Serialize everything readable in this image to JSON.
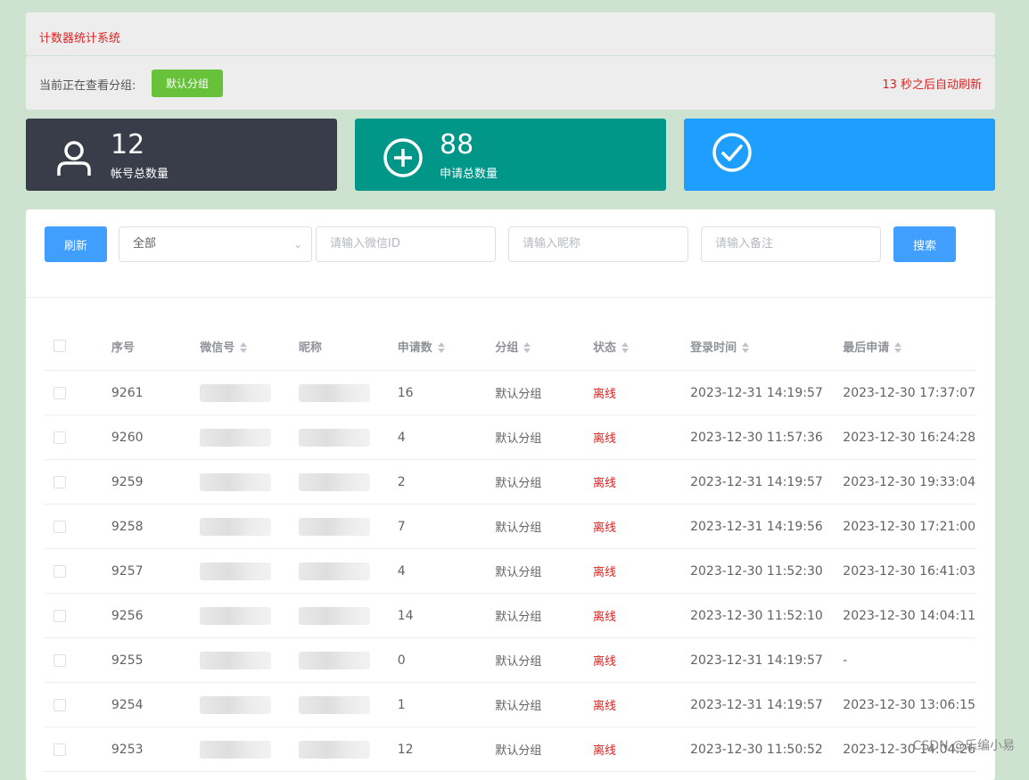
{
  "app_title": "计数器统计系统",
  "group_bar": {
    "label": "当前正在查看分组:",
    "group_button": "默认分组",
    "refresh_countdown": "13 秒之后自动刷新"
  },
  "stats": {
    "accounts": {
      "value": "12",
      "label": "帐号总数量",
      "icon": "user-icon"
    },
    "applications": {
      "value": "88",
      "label": "申请总数量",
      "icon": "plus-circle-icon"
    },
    "done": {
      "icon": "check-circle-icon"
    }
  },
  "toolbar": {
    "refresh_label": "刷新",
    "group_select_value": "全部",
    "wxid_placeholder": "请输入微信ID",
    "nickname_placeholder": "请输入昵称",
    "remark_placeholder": "请输入备注",
    "search_label": "搜索"
  },
  "table": {
    "columns": [
      "序号",
      "微信号",
      "昵称",
      "申请数",
      "分组",
      "状态",
      "登录时间",
      "最后申请"
    ],
    "rows": [
      {
        "no": "9261",
        "count": "16",
        "group": "默认分组",
        "status": "离线",
        "login": "2023-12-31 14:19:57",
        "last": "2023-12-30 17:37:07"
      },
      {
        "no": "9260",
        "count": "4",
        "group": "默认分组",
        "status": "离线",
        "login": "2023-12-30 11:57:36",
        "last": "2023-12-30 16:24:28"
      },
      {
        "no": "9259",
        "count": "2",
        "group": "默认分组",
        "status": "离线",
        "login": "2023-12-31 14:19:57",
        "last": "2023-12-30 19:33:04"
      },
      {
        "no": "9258",
        "count": "7",
        "group": "默认分组",
        "status": "离线",
        "login": "2023-12-31 14:19:56",
        "last": "2023-12-30 17:21:00"
      },
      {
        "no": "9257",
        "count": "4",
        "group": "默认分组",
        "status": "离线",
        "login": "2023-12-30 11:52:30",
        "last": "2023-12-30 16:41:03"
      },
      {
        "no": "9256",
        "count": "14",
        "group": "默认分组",
        "status": "离线",
        "login": "2023-12-30 11:52:10",
        "last": "2023-12-30 14:04:11"
      },
      {
        "no": "9255",
        "count": "0",
        "group": "默认分组",
        "status": "离线",
        "login": "2023-12-31 14:19:57",
        "last": "-"
      },
      {
        "no": "9254",
        "count": "1",
        "group": "默认分组",
        "status": "离线",
        "login": "2023-12-31 14:19:57",
        "last": "2023-12-30 13:06:15"
      },
      {
        "no": "9253",
        "count": "12",
        "group": "默认分组",
        "status": "离线",
        "login": "2023-12-30 11:50:52",
        "last": "2023-12-30 14:04:26"
      }
    ]
  },
  "watermark": "CSDN @乐编小易",
  "colors": {
    "status_offline": "#e02020",
    "primary": "#409eff",
    "success": "#67c23a"
  }
}
